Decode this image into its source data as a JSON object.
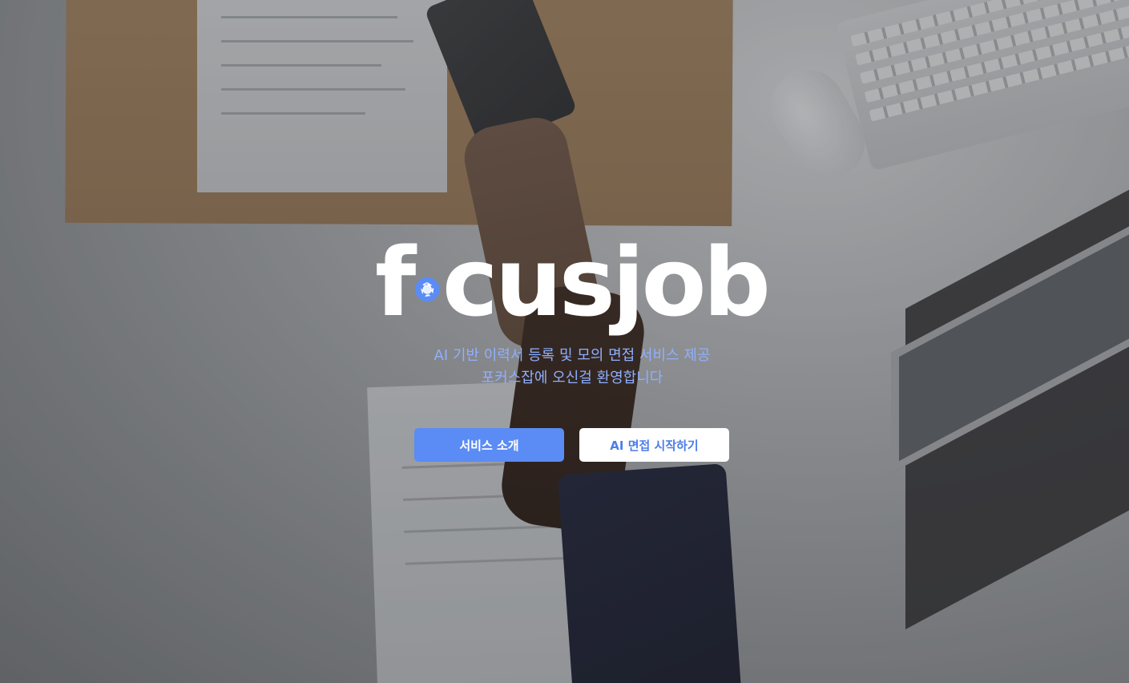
{
  "brand": {
    "logo_prefix": "f",
    "logo_suffix": "cusjob",
    "logo_icon": "camera-aperture-icon",
    "accent_color": "#5b8cf5"
  },
  "hero": {
    "tagline_line1": "AI 기반 이력서 등록 및 모의 면접 서비스 제공",
    "tagline_line2": "포커스잡에 오신걸 환영합니다",
    "tagline_color": "#8fb0ff"
  },
  "actions": {
    "primary_label": "서비스 소개",
    "secondary_label": "AI 면접 시작하기"
  }
}
